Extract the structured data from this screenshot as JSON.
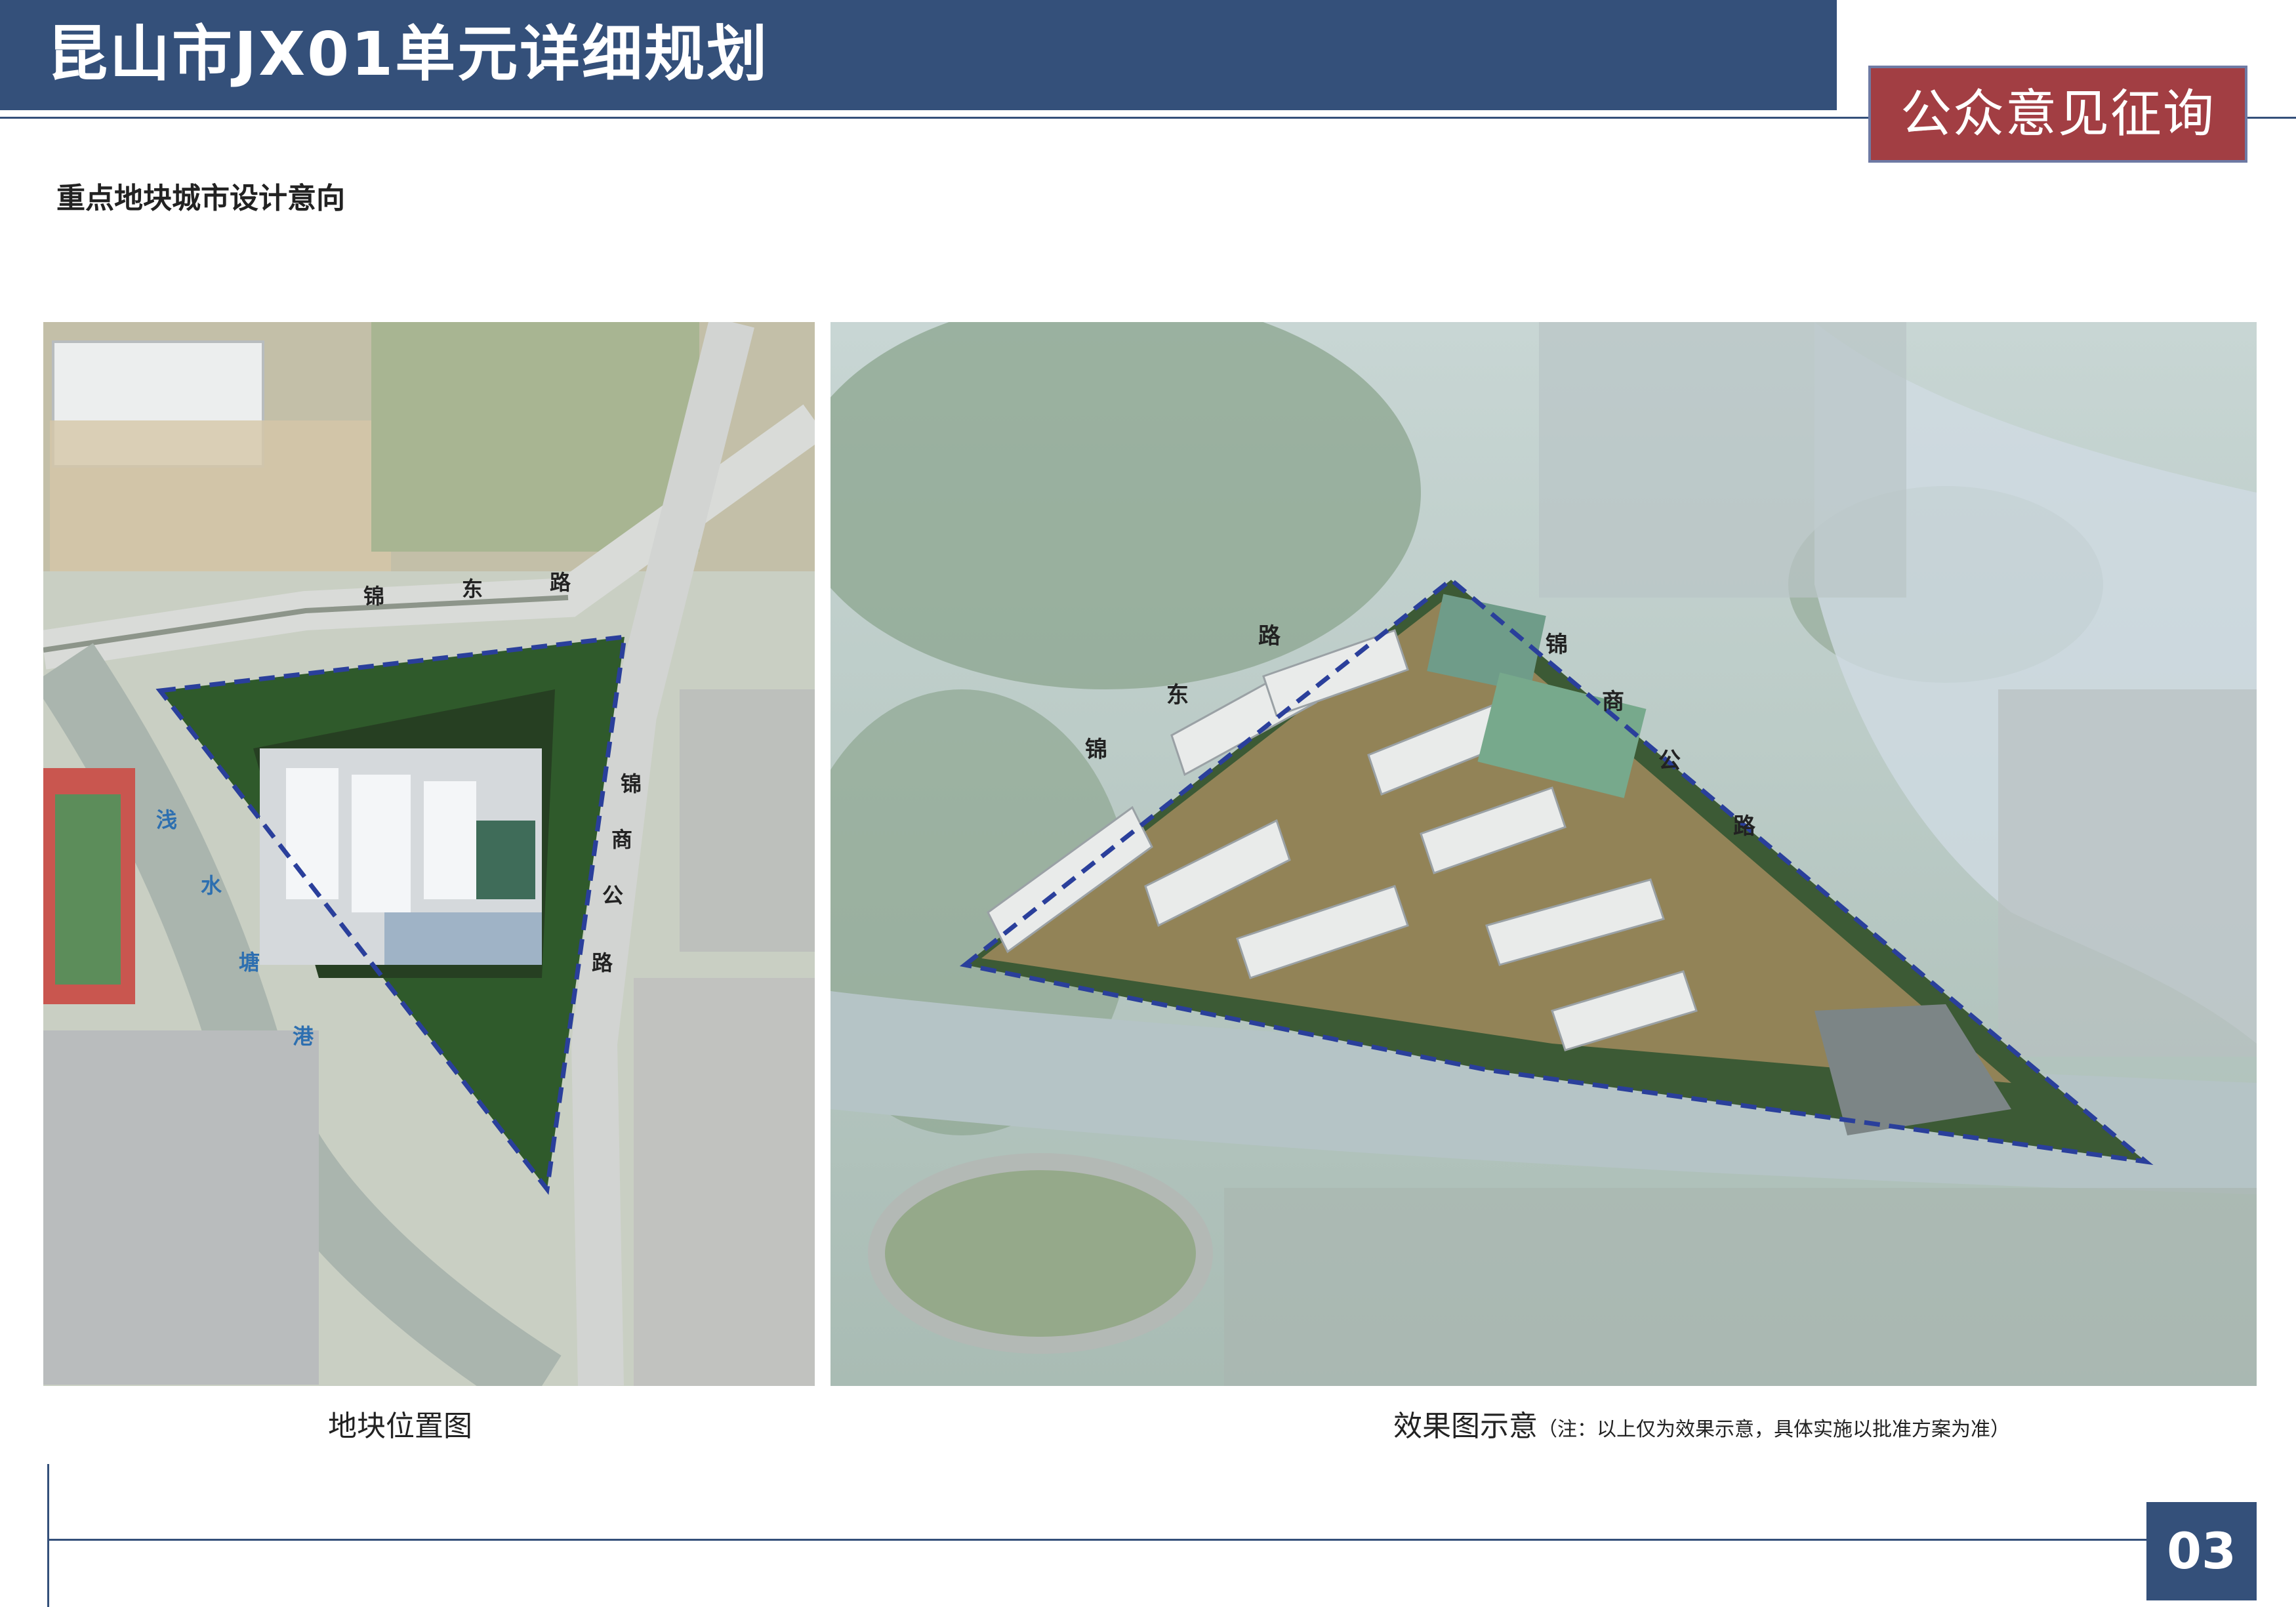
{
  "header": {
    "title": "昆山市JX01单元详细规划",
    "stamp": "公众意见征询"
  },
  "subtitle": "重点地块城市设计意向",
  "location_map": {
    "caption": "地块位置图",
    "road_labels": [
      {
        "text": "锦"
      },
      {
        "text": "东"
      },
      {
        "text": "路"
      },
      {
        "text": "锦"
      },
      {
        "text": "商"
      },
      {
        "text": "公"
      },
      {
        "text": "路"
      }
    ],
    "water_labels": [
      {
        "text": "浅"
      },
      {
        "text": "水"
      },
      {
        "text": "塘"
      },
      {
        "text": "港"
      }
    ]
  },
  "rendering": {
    "caption": "效果图示意",
    "note": "（注：以上仅为效果示意，具体实施以批准方案为准）",
    "road_labels": [
      {
        "text": "锦"
      },
      {
        "text": "东"
      },
      {
        "text": "路"
      },
      {
        "text": "锦"
      },
      {
        "text": "商"
      },
      {
        "text": "公"
      },
      {
        "text": "路"
      }
    ]
  },
  "page_number": "03",
  "colors": {
    "header": "#34507a",
    "stamp": "#a23e43",
    "boundary": "#2a3f9b"
  }
}
